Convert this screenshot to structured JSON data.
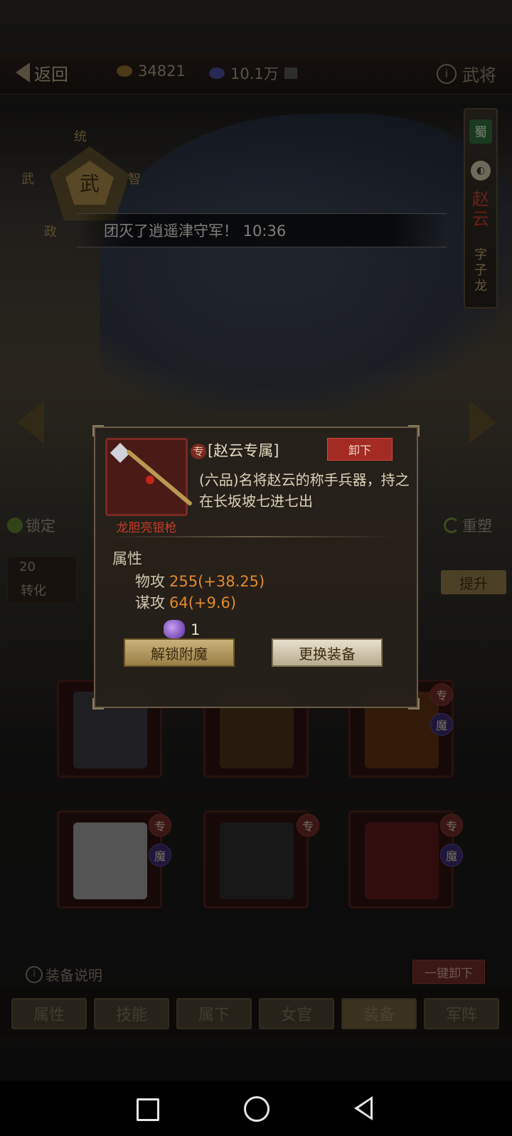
{
  "topbar": {
    "back_label": "返回",
    "coins": "34821",
    "gems": "10.1万",
    "hero_section": "武将",
    "info_glyph": "i"
  },
  "stats": {
    "top": "统",
    "left": "武",
    "right": "智",
    "bottom": "政",
    "center": "武"
  },
  "ticker": "团灭了逍遥津守军！ 10:36",
  "hero": {
    "kingdom": "蜀",
    "name": "赵云",
    "style_name": "字子龙"
  },
  "actions": {
    "lock": "锁定",
    "reshape": "重塑",
    "count": "20",
    "convert": "转化",
    "upgrade": "提升"
  },
  "modal": {
    "exclusive_badge": "专",
    "exclusive_label": "[赵云专属]",
    "remove_button": "卸下",
    "item_name": "龙胆亮银枪",
    "description": "(六品)名将赵云的称手兵器，持之在长坂坡七进七出",
    "attr_title": "属性",
    "attrs": [
      {
        "name": "物攻",
        "value": "255(+38.25)"
      },
      {
        "name": "谋攻",
        "value": "64(+9.6)"
      }
    ],
    "gem_count": "1",
    "unlock_button": "解锁附魔",
    "change_button": "更换装备"
  },
  "slots": [
    {
      "name": "armor",
      "tags": [],
      "color": "#3a3a40"
    },
    {
      "name": "spear",
      "tags": [],
      "color": "#4a3018"
    },
    {
      "name": "bow",
      "tags": [
        "专",
        "魔"
      ],
      "color": "#5a3010"
    },
    {
      "name": "horse",
      "tags": [
        "专",
        "魔"
      ],
      "color": "#bdbdbd"
    },
    {
      "name": "seal",
      "tags": [
        "专"
      ],
      "color": "#2a2a2a"
    },
    {
      "name": "sword",
      "tags": [
        "专",
        "魔"
      ],
      "color": "#8a2020"
    }
  ],
  "bottom": {
    "equip_info": "装备说明",
    "unequip_all": "一键卸下",
    "tabs": [
      "属性",
      "技能",
      "属下",
      "女官",
      "装备",
      "军阵"
    ],
    "active_tab": 4
  },
  "colors": {
    "accent_gold": "#a28446",
    "danger_red": "#a42a24",
    "value_orange": "#e28a2c"
  }
}
